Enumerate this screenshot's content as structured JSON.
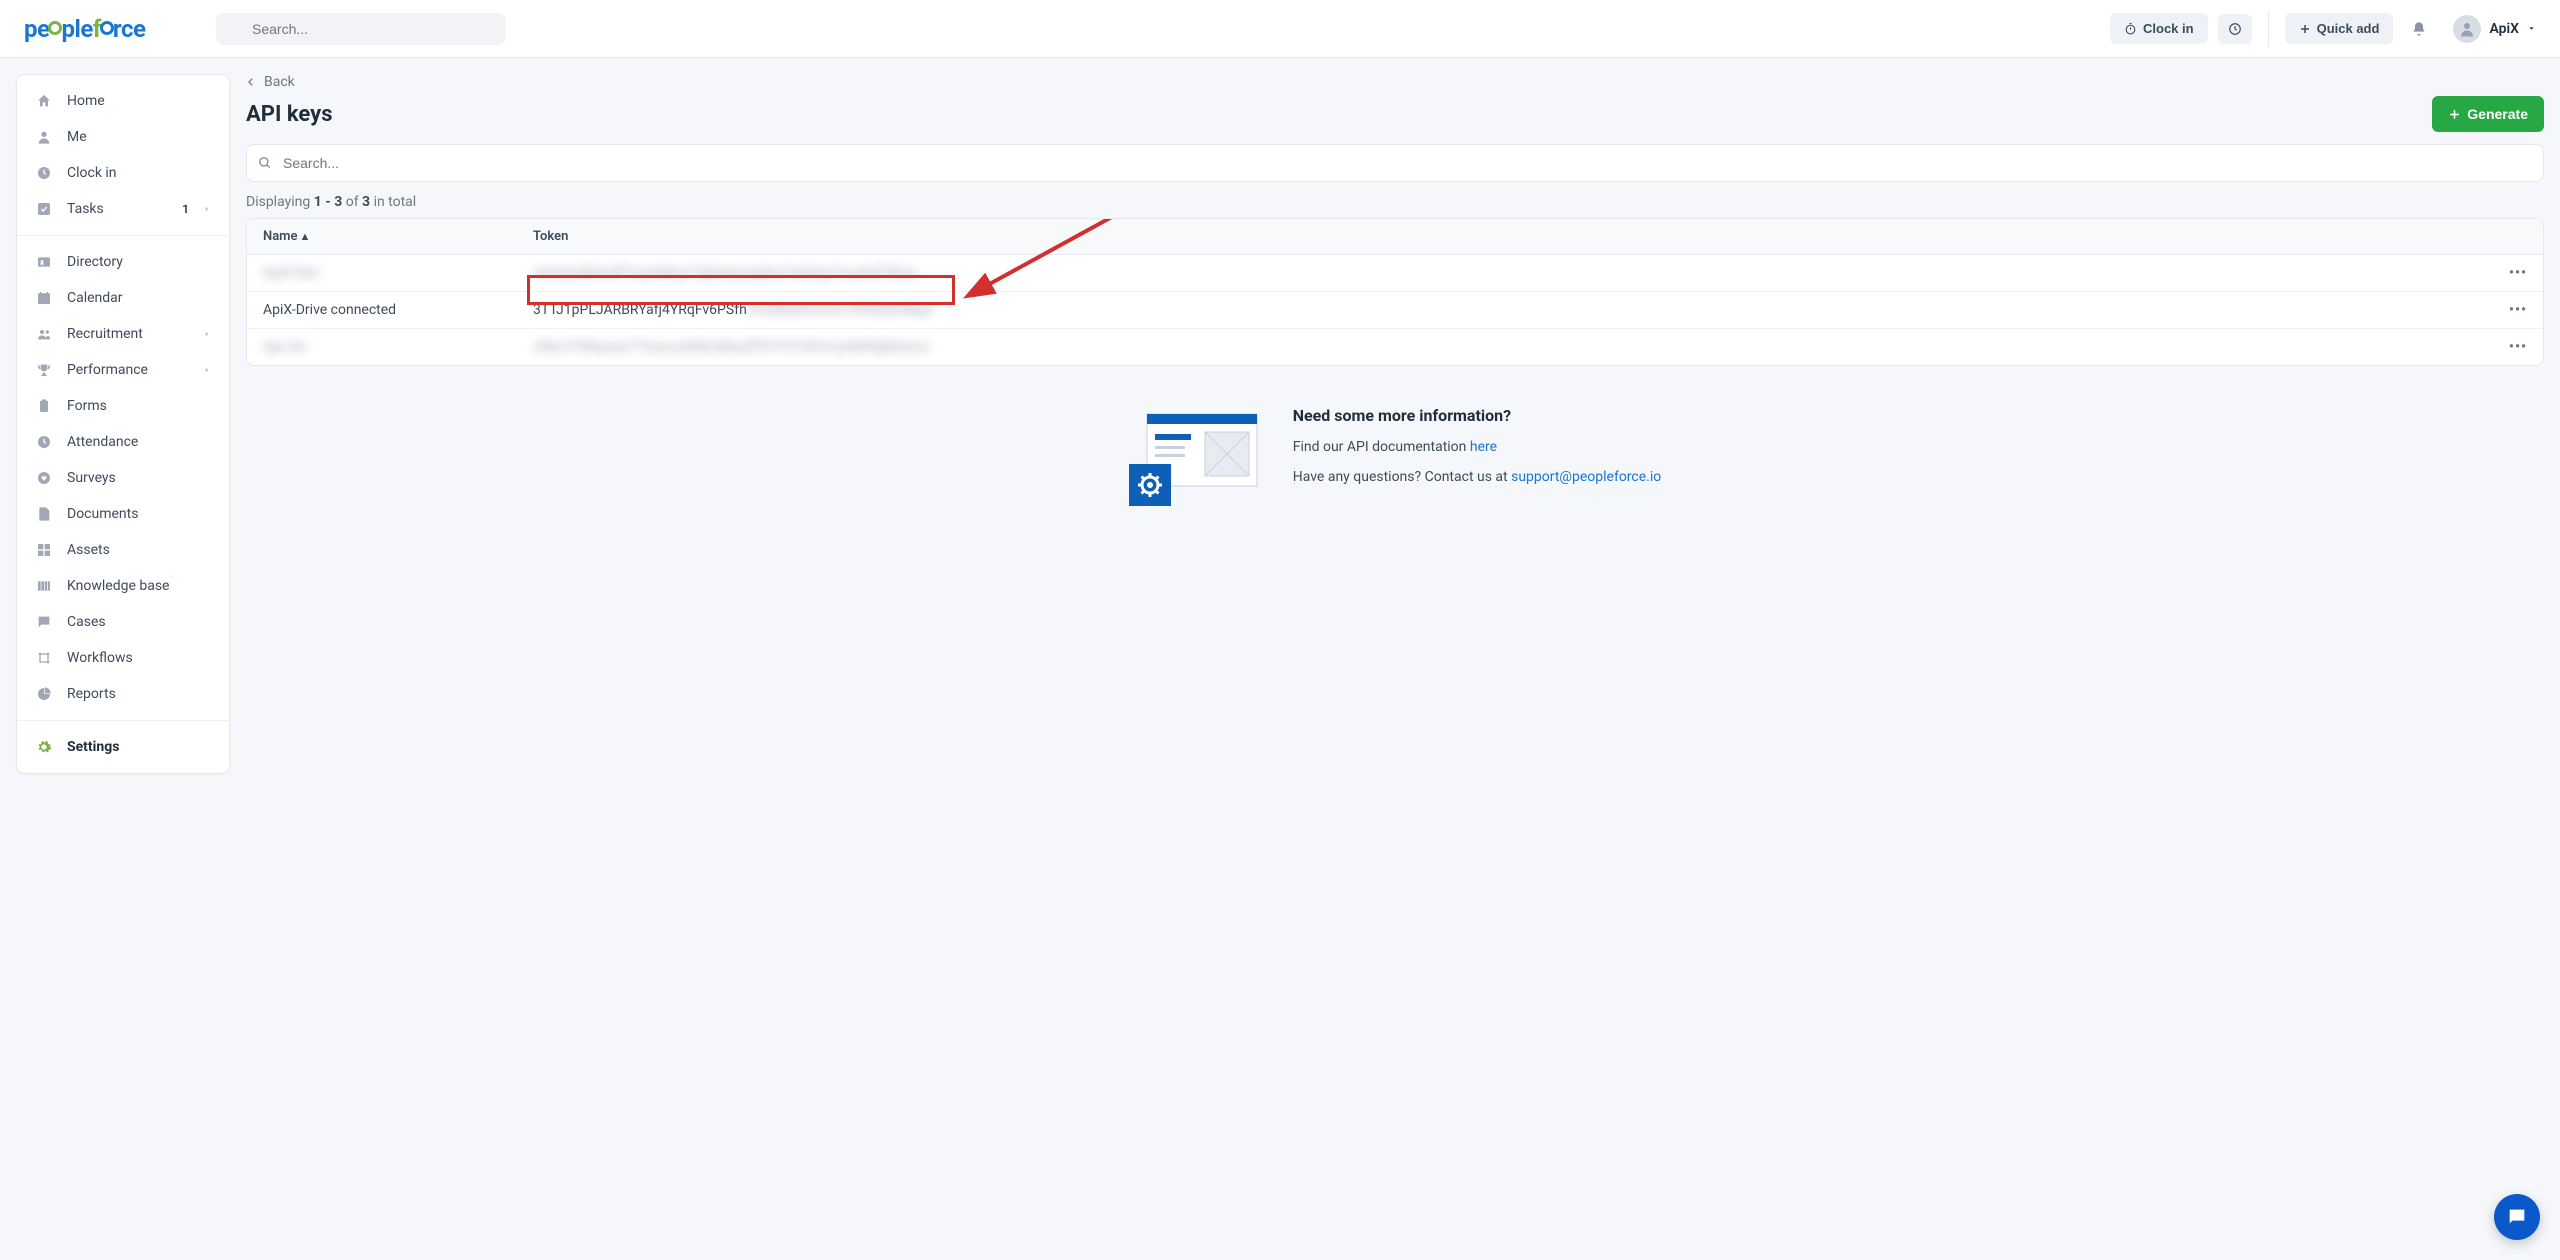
{
  "header": {
    "search_placeholder": "Search...",
    "clock_in": "Clock in",
    "quick_add": "Quick add",
    "user_name": "ApiX"
  },
  "sidebar": {
    "items_top": [
      {
        "label": "Home",
        "icon": "home"
      },
      {
        "label": "Me",
        "icon": "person"
      },
      {
        "label": "Clock in",
        "icon": "clock"
      },
      {
        "label": "Tasks",
        "icon": "check",
        "badge": "1",
        "chevron": true
      }
    ],
    "items_main": [
      {
        "label": "Directory",
        "icon": "id"
      },
      {
        "label": "Calendar",
        "icon": "calendar"
      },
      {
        "label": "Recruitment",
        "icon": "group",
        "chevron": true
      },
      {
        "label": "Performance",
        "icon": "trophy",
        "chevron": true
      },
      {
        "label": "Forms",
        "icon": "clipboard"
      },
      {
        "label": "Attendance",
        "icon": "clock2"
      },
      {
        "label": "Surveys",
        "icon": "heart"
      },
      {
        "label": "Documents",
        "icon": "doc"
      },
      {
        "label": "Assets",
        "icon": "boxes"
      },
      {
        "label": "Knowledge base",
        "icon": "book"
      },
      {
        "label": "Cases",
        "icon": "chat"
      },
      {
        "label": "Workflows",
        "icon": "flow"
      },
      {
        "label": "Reports",
        "icon": "pie"
      }
    ],
    "items_bottom": [
      {
        "label": "Settings",
        "icon": "gear",
        "active": true
      }
    ]
  },
  "page": {
    "back": "Back",
    "title": "API keys",
    "generate": "Generate",
    "search_placeholder": "Search...",
    "displaying_prefix": "Displaying ",
    "displaying_range": "1 - 3",
    "displaying_of": " of ",
    "displaying_total": "3",
    "displaying_suffix": " in total"
  },
  "table": {
    "headers": {
      "name": "Name",
      "token": "Token"
    },
    "rows": [
      {
        "name": "ApiX blur",
        "token": "xhxkqndkfeuf9Toyuhbkyz7ghhekyudplecYeddoy7ocuKdT0Eos",
        "blurred": true
      },
      {
        "name": "ApiX-Drive connected",
        "token": "3TTJ1pPLJARBRYafj4YRqFv6PSfhUmdSpklnhrtLfLrfRGkQtrNkgY",
        "highlight": true
      },
      {
        "name": "Apx blr",
        "token": "zfbwvTldhpsao7TtosouvblthsdboyPfO197C6hVcyzbW9ghkwtuz",
        "blurred": true
      }
    ]
  },
  "info": {
    "title": "Need some more information?",
    "line1_prefix": "Find our API documentation ",
    "line1_link": "here",
    "line2_prefix": "Have any questions? Contact us at ",
    "line2_link": "support@peopleforce.io"
  }
}
